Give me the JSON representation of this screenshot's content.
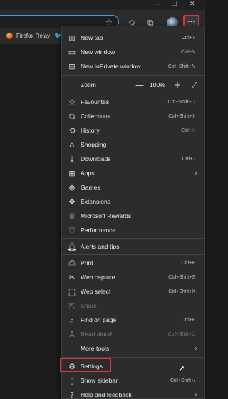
{
  "window": {
    "minimize_icon": "minimize-icon",
    "maximize_icon": "restore-icon",
    "close_icon": "close-icon"
  },
  "toolbar": {
    "more_label": "···"
  },
  "favorites_bar": {
    "items": [
      {
        "label": "Firefox Relay",
        "icon": "firefox-relay-icon"
      }
    ]
  },
  "menu": {
    "new_tab": {
      "label": "New tab",
      "shortcut": "Ctrl+T"
    },
    "new_window": {
      "label": "New window",
      "shortcut": "Ctrl+N"
    },
    "new_inprivate": {
      "label": "New InPrivate window",
      "shortcut": "Ctrl+Shift+N"
    },
    "zoom": {
      "label": "Zoom",
      "value": "100%",
      "minus": "—",
      "plus": "+"
    },
    "favourites": {
      "label": "Favourites",
      "shortcut": "Ctrl+Shift+O"
    },
    "collections": {
      "label": "Collections",
      "shortcut": "Ctrl+Shift+Y"
    },
    "history": {
      "label": "History",
      "shortcut": "Ctrl+H"
    },
    "shopping": {
      "label": "Shopping"
    },
    "downloads": {
      "label": "Downloads",
      "shortcut": "Ctrl+J"
    },
    "apps": {
      "label": "Apps"
    },
    "games": {
      "label": "Games"
    },
    "extensions": {
      "label": "Extensions"
    },
    "rewards": {
      "label": "Microsoft Rewards"
    },
    "performance": {
      "label": "Performance"
    },
    "alerts": {
      "label": "Alerts and tips"
    },
    "print": {
      "label": "Print",
      "shortcut": "Ctrl+P"
    },
    "web_capture": {
      "label": "Web capture",
      "shortcut": "Ctrl+Shift+S"
    },
    "web_select": {
      "label": "Web select",
      "shortcut": "Ctrl+Shift+X"
    },
    "share": {
      "label": "Share"
    },
    "find": {
      "label": "Find on page",
      "shortcut": "Ctrl+F"
    },
    "read_aloud": {
      "label": "Read aloud",
      "shortcut": "Ctrl+Shift+U"
    },
    "more_tools": {
      "label": "More tools"
    },
    "settings": {
      "label": "Settings"
    },
    "show_sidebar": {
      "label": "Show sidebar",
      "shortcut": "Ctrl+Shift+/"
    },
    "help": {
      "label": "Help and feedback"
    }
  },
  "colors": {
    "highlight": "#e2353a",
    "address_border": "#3b9eea",
    "menu_bg": "#2c2c2c"
  }
}
